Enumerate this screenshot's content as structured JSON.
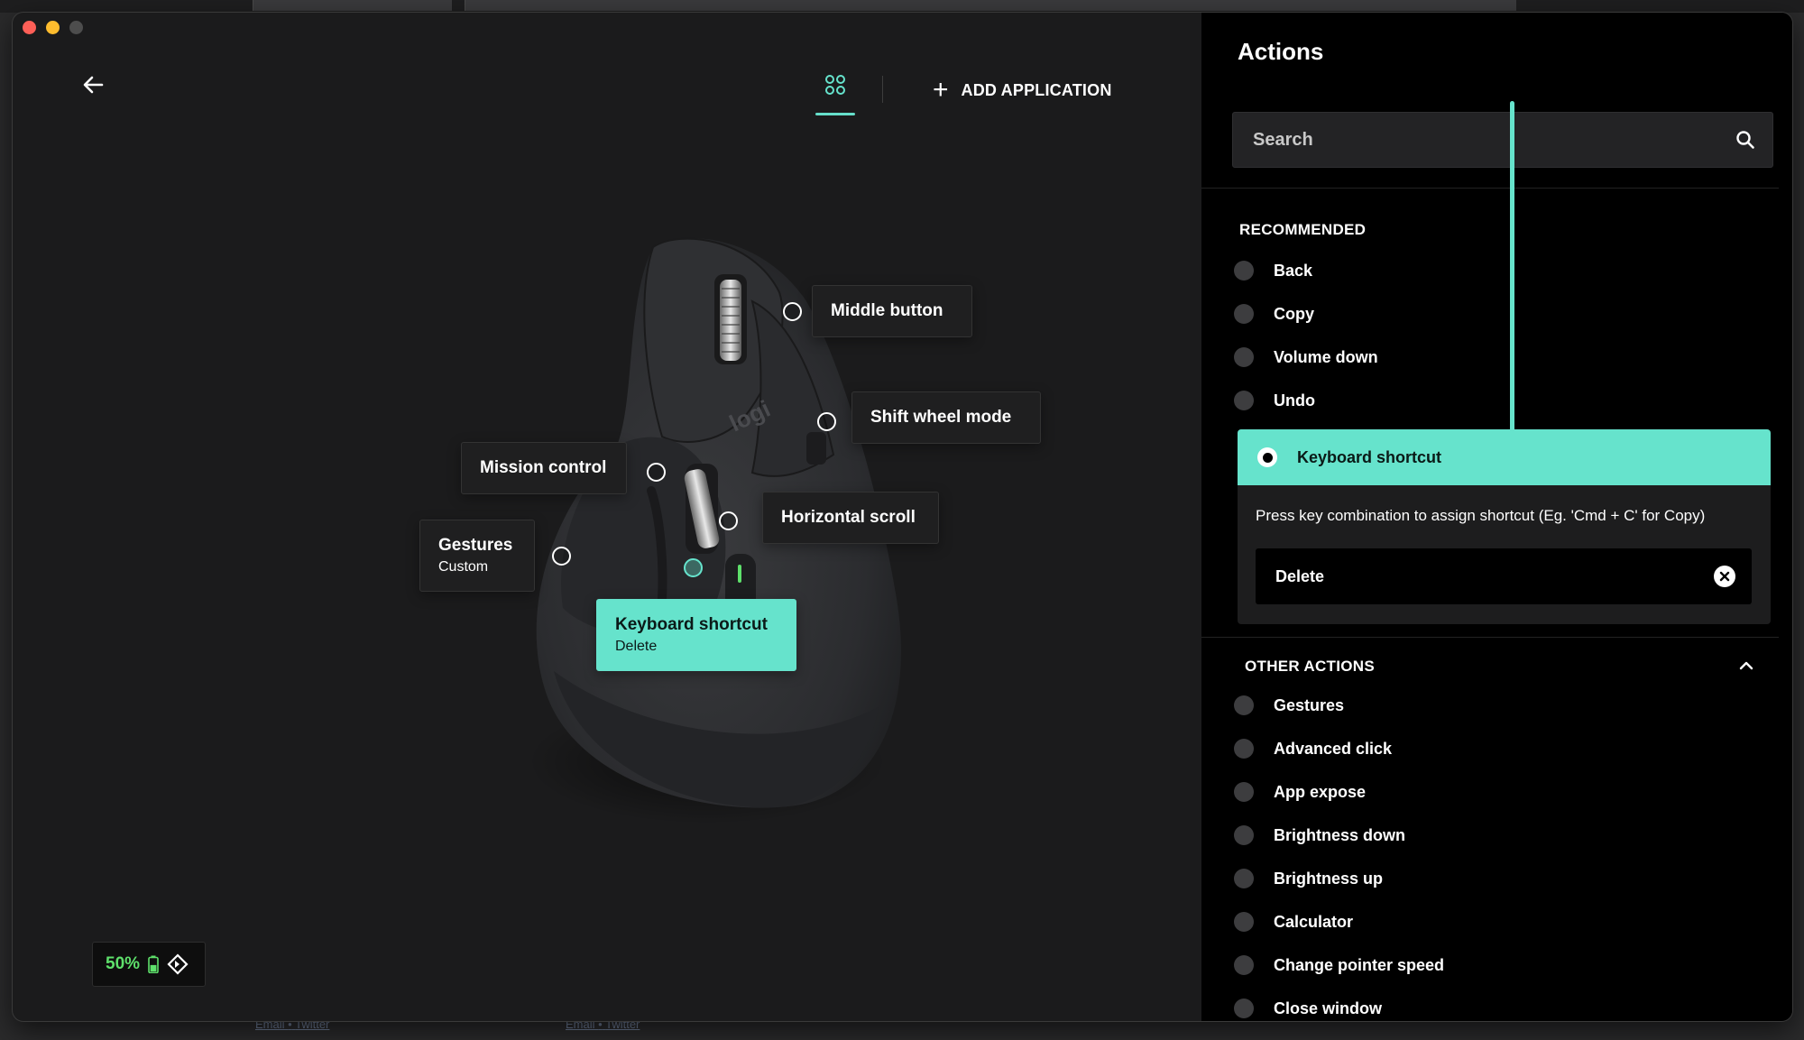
{
  "background": {
    "footer_links_1": [
      "Email",
      "Twitter"
    ],
    "footer_links_2": [
      "Email",
      "Twitter"
    ],
    "separator": "•"
  },
  "toolbar": {
    "back_icon": "arrow-left-icon",
    "apps_icon": "grid-icon",
    "add_application_label": "ADD APPLICATION"
  },
  "mouse": {
    "brand_text": "logi",
    "callouts": {
      "middle_button": "Middle button",
      "shift_wheel_mode": "Shift wheel mode",
      "mission_control": "Mission control",
      "horizontal_scroll": "Horizontal scroll",
      "gestures_title": "Gestures",
      "gestures_sub": "Custom",
      "keyboard_shortcut_title": "Keyboard shortcut",
      "keyboard_shortcut_sub": "Delete"
    }
  },
  "battery": {
    "percent": "50%",
    "level": 0.5,
    "accent": "#5ee06b"
  },
  "panel": {
    "title": "Actions",
    "search_placeholder": "Search",
    "recommended_header": "RECOMMENDED",
    "recommended": [
      "Back",
      "Copy",
      "Volume down",
      "Undo"
    ],
    "selected": {
      "label": "Keyboard shortcut",
      "hint": "Press key combination to assign shortcut (Eg. 'Cmd + C' for Copy)",
      "value": "Delete"
    },
    "other_header": "OTHER ACTIONS",
    "other": [
      "Gestures",
      "Advanced click",
      "App expose",
      "Brightness down",
      "Brightness up",
      "Calculator",
      "Change pointer speed",
      "Close window"
    ]
  },
  "colors": {
    "accent": "#66e3cc",
    "panel_bg": "#000000",
    "main_bg": "#1b1b1c"
  }
}
